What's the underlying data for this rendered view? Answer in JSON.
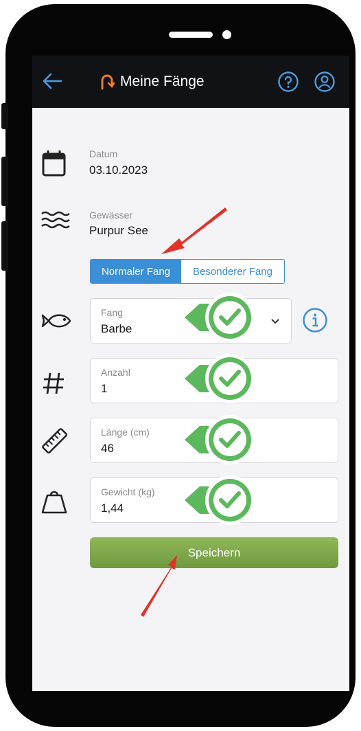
{
  "header": {
    "title": "Meine Fänge"
  },
  "datum": {
    "label": "Datum",
    "value": "03.10.2023"
  },
  "gewaesser": {
    "label": "Gewässer",
    "value": "Purpur See"
  },
  "catch_type": {
    "selected": "Normaler Fang",
    "other": "Besonderer Fang"
  },
  "fang": {
    "label": "Fang",
    "value": "Barbe"
  },
  "anzahl": {
    "label": "Anzahl",
    "value": "1"
  },
  "laenge": {
    "label": "Länge (cm)",
    "value": "46"
  },
  "gewicht": {
    "label": "Gewicht (kg)",
    "value": "1,44"
  },
  "save_label": "Speichern",
  "colors": {
    "accent": "#3a8fd6",
    "save": "#7aa648",
    "check": "#5cb85c",
    "annotation": "#e0332a"
  }
}
